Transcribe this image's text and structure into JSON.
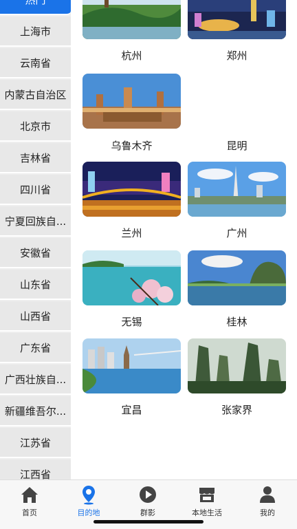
{
  "sidebar": {
    "items": [
      {
        "label": "热门",
        "active": true
      },
      {
        "label": "上海市"
      },
      {
        "label": "云南省"
      },
      {
        "label": "内蒙古自治区"
      },
      {
        "label": "北京市"
      },
      {
        "label": "吉林省"
      },
      {
        "label": "四川省"
      },
      {
        "label": "宁夏回族自..."
      },
      {
        "label": "安徽省"
      },
      {
        "label": "山东省"
      },
      {
        "label": "山西省"
      },
      {
        "label": "广东省"
      },
      {
        "label": "广西壮族自..."
      },
      {
        "label": "新疆维吾尔..."
      },
      {
        "label": "江苏省"
      },
      {
        "label": "江西省"
      }
    ]
  },
  "cities": [
    {
      "name": "杭州"
    },
    {
      "name": "郑州"
    },
    {
      "name": "乌鲁木齐"
    },
    {
      "name": "昆明"
    },
    {
      "name": "兰州"
    },
    {
      "name": "广州"
    },
    {
      "name": "无锡"
    },
    {
      "name": "桂林"
    },
    {
      "name": "宜昌"
    },
    {
      "name": "张家界"
    }
  ],
  "tabbar": {
    "tabs": [
      {
        "label": "首页",
        "icon": "home-icon"
      },
      {
        "label": "目的地",
        "icon": "location-pin-icon",
        "active": true
      },
      {
        "label": "群影",
        "icon": "play-icon"
      },
      {
        "label": "本地生活",
        "icon": "shop-icon"
      },
      {
        "label": "我的",
        "icon": "user-icon"
      }
    ]
  },
  "colors": {
    "accent": "#1a73e8",
    "sidebar_bg": "#e8e8e8",
    "tab_icon": "#444444"
  }
}
